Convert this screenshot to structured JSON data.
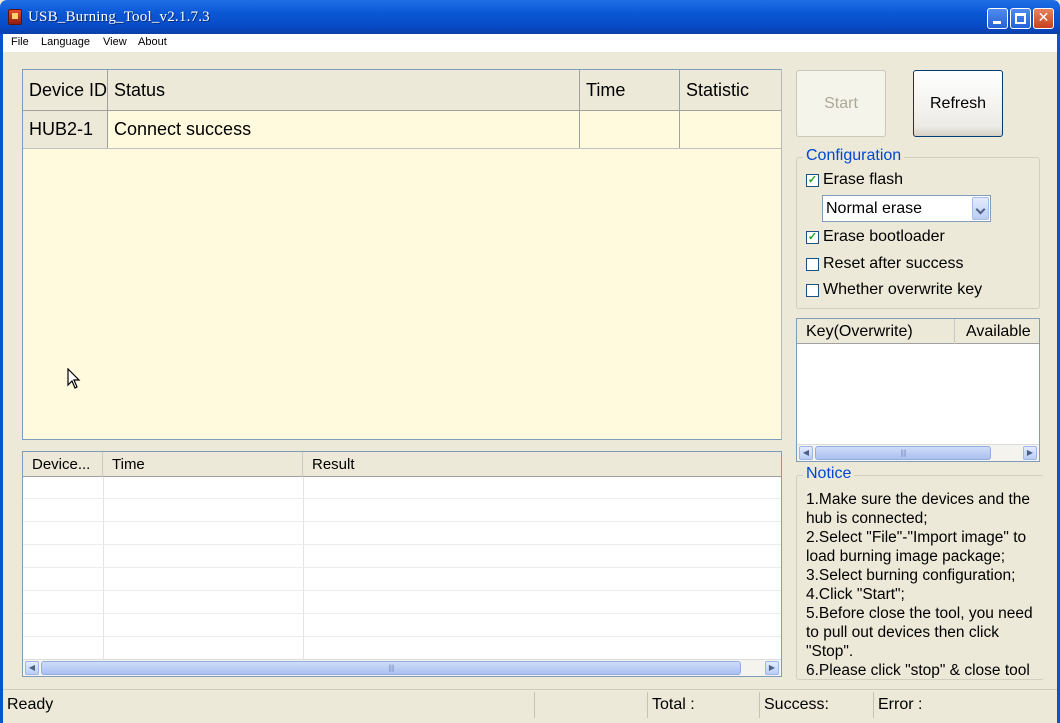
{
  "window": {
    "title": "USB_Burning_Tool_v2.1.7.3"
  },
  "menu": {
    "file": "File",
    "language": "Language",
    "view": "View",
    "about": "About"
  },
  "device_table": {
    "columns": [
      "Device ID",
      "Status",
      "Time",
      "Statistic"
    ],
    "rows": [
      {
        "device_id": "HUB2-1",
        "status": "Connect success",
        "time": "",
        "statistic": ""
      }
    ]
  },
  "log_table": {
    "columns": [
      "Device...",
      "Time",
      "Result"
    ]
  },
  "buttons": {
    "start": "Start",
    "refresh": "Refresh"
  },
  "configuration": {
    "title": "Configuration",
    "erase_flash": {
      "label": "Erase flash",
      "checked": true
    },
    "erase_mode": "Normal erase",
    "erase_bootloader": {
      "label": "Erase bootloader",
      "checked": true
    },
    "reset_after_success": {
      "label": "Reset after success",
      "checked": false
    },
    "overwrite_key": {
      "label": "Whether overwrite key",
      "checked": false
    }
  },
  "key_table": {
    "columns": [
      "Key(Overwrite)",
      "Available"
    ]
  },
  "notice": {
    "title": "Notice",
    "lines": [
      "1.Make sure the devices and the hub is connected;",
      "2.Select \"File\"-\"Import image\" to load burning image package;",
      "3.Select burning configuration;",
      "4.Click \"Start\";",
      "5.Before close the tool, you need to pull out devices then click \"Stop\".",
      "6.Please click \"stop\" & close tool"
    ]
  },
  "status_bar": {
    "state": "Ready",
    "total": "Total :",
    "success": "Success:",
    "error": "Error :"
  }
}
